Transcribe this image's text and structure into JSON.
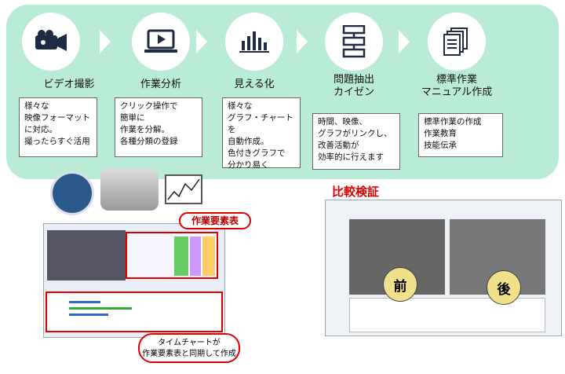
{
  "steps": [
    {
      "title": "ビデオ撮影",
      "icon": "video-camera-icon",
      "desc": "様々な\n映像フォーマット\nに対応。\n撮ったらすぐ活用"
    },
    {
      "title": "作業分析",
      "icon": "laptop-play-icon",
      "desc": "クリック操作で\n簡単に\n作業を分解。\n各種分類の登録"
    },
    {
      "title": "見える化",
      "icon": "bar-chart-icon",
      "desc": "様々な\nグラフ・チャートを\n自動作成。\n色付きグラフで\n分かり易く"
    },
    {
      "title": "問題抽出\nカイゼン",
      "icon": "flowchart-icon",
      "desc": "時間、映像、\nグラフがリンクし、\n改善活動が\n効率的に行えます"
    },
    {
      "title": "標準作業\nマニュアル作成",
      "icon": "documents-icon",
      "desc": "標準作業の作成\n作業教育\n技能伝承"
    }
  ],
  "labels": {
    "element_table": "作業要素表",
    "time_chart_note": "タイムチャートが\n作業要素表と同期して作成",
    "comparison": "比較検証",
    "before": "前",
    "after": "後"
  },
  "colors": {
    "band": "#b9ecd6",
    "accent_red": "#e00000",
    "icon_dark": "#1f2a44"
  }
}
